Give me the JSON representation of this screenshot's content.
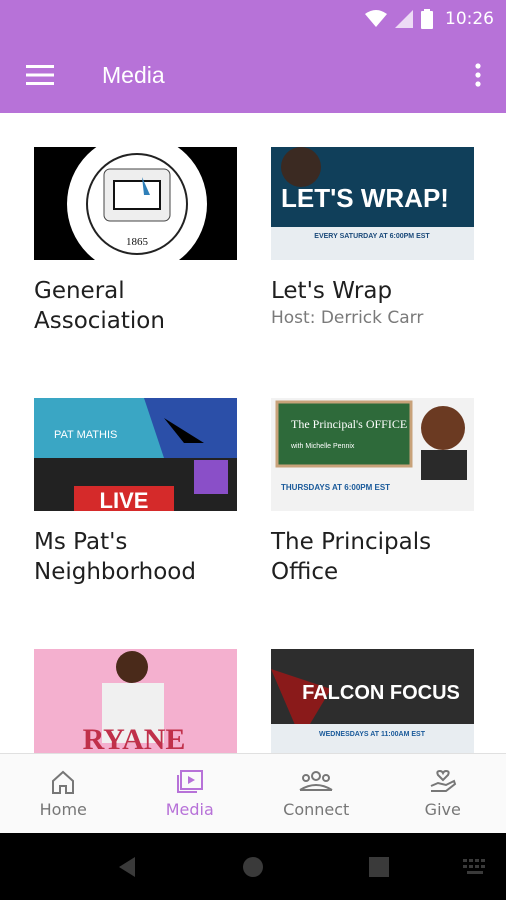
{
  "status_bar": {
    "time": "10:26"
  },
  "app_bar": {
    "title": "Media"
  },
  "media_items": [
    {
      "title": "General Association",
      "subtitle": "",
      "thumb_text": "1865"
    },
    {
      "title": "Let's Wrap",
      "subtitle": "Host: Derrick Carr",
      "thumb_text": "LET'S WRAP!",
      "thumb_sub": "EVERY SATURDAY AT 6:00PM EST"
    },
    {
      "title": "Ms Pat's Neighborhood",
      "subtitle": "",
      "thumb_text": "LIVE",
      "thumb_sub": "PAT MATHIS"
    },
    {
      "title": "The Principals Office",
      "subtitle": "",
      "thumb_text": "The Principal's OFFICE",
      "thumb_sub": "THURSDAYS AT 6:00PM EST",
      "thumb_small": "with Michelle Pennix"
    },
    {
      "title": "",
      "subtitle": "",
      "thumb_text": "RYANE"
    },
    {
      "title": "",
      "subtitle": "",
      "thumb_text": "FALCON FOCUS",
      "thumb_sub": "WEDNESDAYS AT 11:00AM EST"
    }
  ],
  "bottom_nav": [
    {
      "label": "Home",
      "icon": "home-icon"
    },
    {
      "label": "Media",
      "icon": "media-icon"
    },
    {
      "label": "Connect",
      "icon": "connect-icon"
    },
    {
      "label": "Give",
      "icon": "give-icon"
    }
  ],
  "colors": {
    "accent": "#b772d8"
  }
}
